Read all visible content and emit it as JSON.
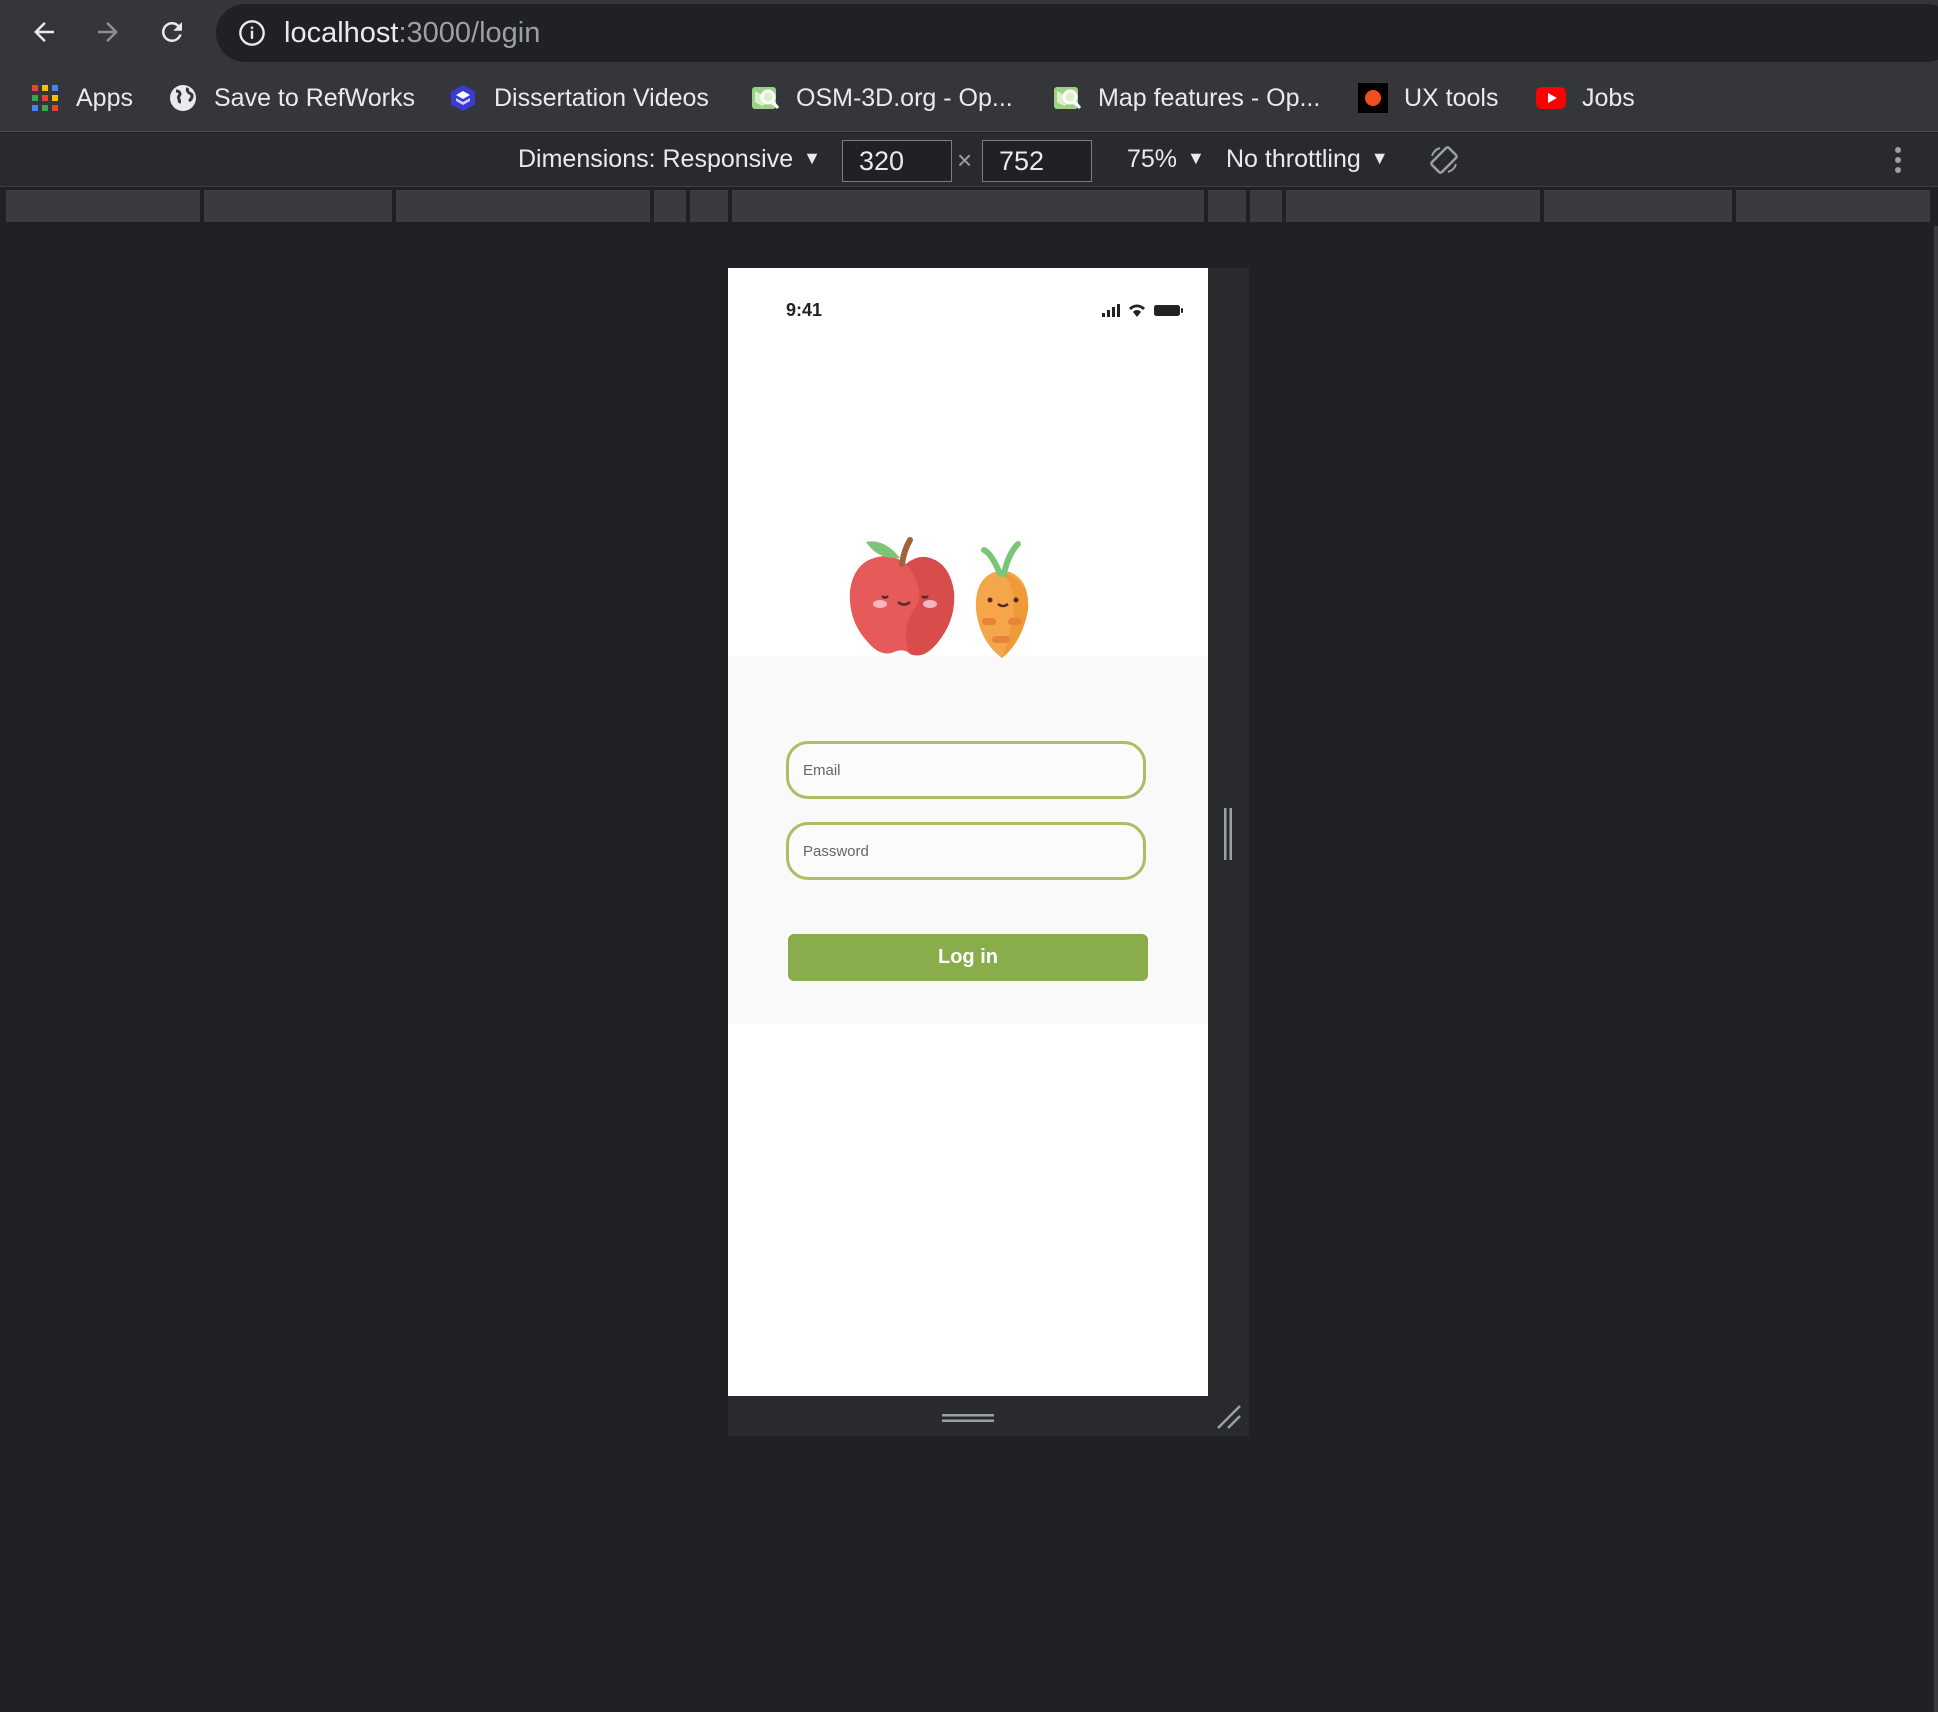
{
  "browser": {
    "url_host": "localhost",
    "url_path": ":3000/login"
  },
  "bookmarks": [
    {
      "label": "Apps",
      "icon": "apps-grid-icon"
    },
    {
      "label": "Save to RefWorks",
      "icon": "globe-icon"
    },
    {
      "label": "Dissertation Videos",
      "icon": "hexagon-layers-icon"
    },
    {
      "label": "OSM-3D.org - Op...",
      "icon": "map-globe-icon"
    },
    {
      "label": "Map features - Op...",
      "icon": "map-globe-icon"
    },
    {
      "label": "UX tools",
      "icon": "red-dot-icon"
    },
    {
      "label": "Jobs",
      "icon": "youtube-icon"
    }
  ],
  "device_toolbar": {
    "dimensions_label": "Dimensions: Responsive",
    "width": "320",
    "height": "752",
    "zoom": "75%",
    "throttling": "No throttling"
  },
  "app": {
    "status_time": "9:41",
    "email_placeholder": "Email",
    "password_placeholder": "Password",
    "login_label": "Log in"
  },
  "colors": {
    "field_border": "#a8bf63",
    "login_button": "#8aad4b",
    "apple": "#e65a5a",
    "carrot": "#f5a54a"
  }
}
